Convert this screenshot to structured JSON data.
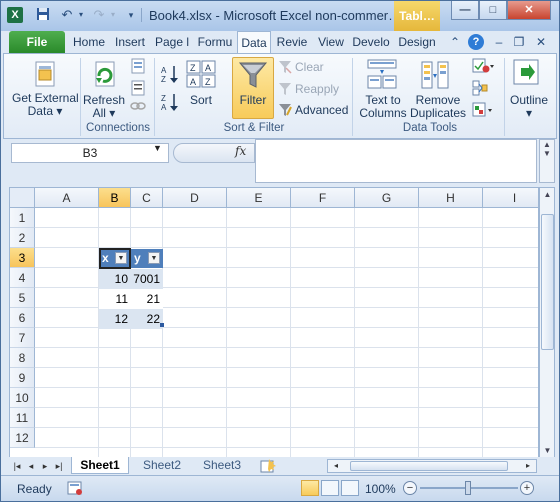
{
  "titlebar": {
    "app_glyph": "X",
    "title": "Book4.xlsx - Microsoft Excel non-commer…",
    "contextual_tab": "Tabl…",
    "minimize": "—",
    "maximize": "□",
    "close": "✕"
  },
  "ribbon_tabs": {
    "file": "File",
    "home": "Home",
    "insert": "Insert",
    "page_layout": "Page l",
    "formulas": "Formu",
    "data": "Data",
    "review": "Revie",
    "view": "View",
    "developer": "Develo",
    "design": "Design"
  },
  "ribbon": {
    "get_external_data": {
      "line1": "Get External",
      "line2": "Data ▾"
    },
    "refresh_all": {
      "line1": "Refresh",
      "line2": "All ▾"
    },
    "connections_group": "Connections",
    "sort": "Sort",
    "filter": "Filter",
    "clear": "Clear",
    "reapply": "Reapply",
    "advanced": "Advanced",
    "sort_filter_group": "Sort & Filter",
    "text_to_columns": {
      "line1": "Text to",
      "line2": "Columns"
    },
    "remove_duplicates": {
      "line1": "Remove",
      "line2": "Duplicates"
    },
    "data_tools_group": "Data Tools",
    "outline": "Outline",
    "outline_arrow": "▾"
  },
  "formula_bar": {
    "name_box": "B3",
    "fx": "fx",
    "formula": ""
  },
  "grid": {
    "columns": [
      "A",
      "B",
      "C",
      "D",
      "E",
      "F",
      "G",
      "H",
      "I"
    ],
    "rows": [
      "1",
      "2",
      "3",
      "4",
      "5",
      "6",
      "7",
      "8",
      "9",
      "10",
      "11",
      "12"
    ],
    "selected_column": "B",
    "selected_row": "3"
  },
  "table": {
    "headers": [
      "x",
      "y"
    ],
    "rows": [
      [
        "10",
        "7001"
      ],
      [
        "11",
        "21"
      ],
      [
        "12",
        "22"
      ]
    ]
  },
  "sheet_tabs": [
    "Sheet1",
    "Sheet2",
    "Sheet3"
  ],
  "status": {
    "ready": "Ready",
    "zoom": "100%"
  },
  "colors": {
    "table_header": "#4f7fbb",
    "table_band": "#dbe5f1",
    "selection_highlight": "#f7c45b",
    "file_tab": "#2a8a2a"
  }
}
